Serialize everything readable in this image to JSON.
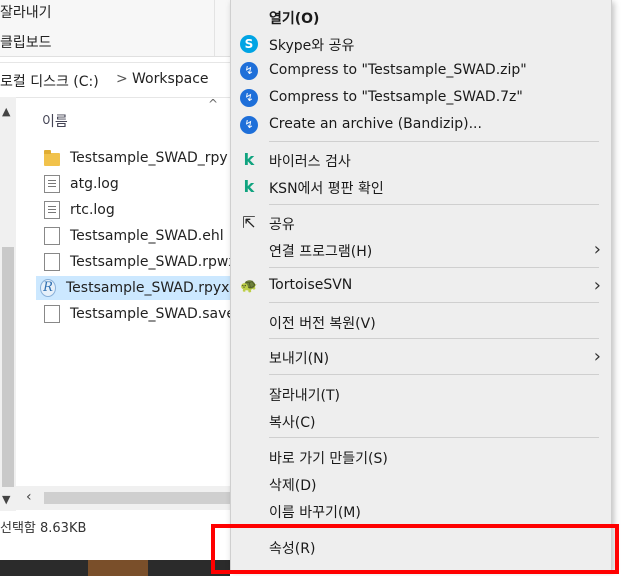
{
  "explorer": {
    "ribbon": {
      "cut_label": "잘라내기",
      "clipboard_label": "클립보드"
    },
    "address": {
      "drive_label": "로컬 디스크 (C:)",
      "separator": ">",
      "folder_label": "Workspace"
    },
    "list": {
      "column_name": "이름",
      "sort_glyph": "^",
      "files": [
        {
          "name": "Testsample_SWAD_rpy",
          "icon": "folder-icon",
          "selected": false
        },
        {
          "name": "atg.log",
          "icon": "text-file-icon",
          "selected": false
        },
        {
          "name": "rtc.log",
          "icon": "text-file-icon",
          "selected": false
        },
        {
          "name": "Testsample_SWAD.ehl",
          "icon": "file-icon",
          "selected": false
        },
        {
          "name": "Testsample_SWAD.rpwx",
          "icon": "file-icon",
          "selected": false
        },
        {
          "name": "Testsample_SWAD.rpyx",
          "icon": "rhapsody-file-icon",
          "selected": true
        },
        {
          "name": "Testsample_SWAD.save",
          "icon": "file-icon",
          "selected": false
        }
      ]
    },
    "status": {
      "selection_text": "선택함 8.63KB"
    }
  },
  "context_menu": {
    "items": [
      {
        "id": "open",
        "label": "열기(O)",
        "icon": "",
        "bold": true
      },
      {
        "id": "skype-share",
        "label": "Skype와 공유",
        "icon": "skype-icon"
      },
      {
        "id": "compress-zip",
        "label": "Compress to \"Testsample_SWAD.zip\"",
        "icon": "bandizip-icon"
      },
      {
        "id": "compress-7z",
        "label": "Compress to \"Testsample_SWAD.7z\"",
        "icon": "bandizip-icon"
      },
      {
        "id": "create-archive",
        "label": "Create an archive (Bandizip)...",
        "icon": "bandizip-icon"
      },
      {
        "id": "virus-scan",
        "label": "바이러스 검사",
        "icon": "kaspersky-icon"
      },
      {
        "id": "ksn-check",
        "label": "KSN에서 평판 확인",
        "icon": "kaspersky-icon"
      },
      {
        "id": "share",
        "label": "공유",
        "icon": "share-icon"
      },
      {
        "id": "open-with",
        "label": "연결 프로그램(H)",
        "icon": "",
        "submenu": true
      },
      {
        "id": "tortoisesvn",
        "label": "TortoiseSVN",
        "icon": "tortoisesvn-icon",
        "submenu": true
      },
      {
        "id": "restore-previous",
        "label": "이전 버전 복원(V)",
        "icon": ""
      },
      {
        "id": "send-to",
        "label": "보내기(N)",
        "icon": "",
        "submenu": true
      },
      {
        "id": "cut",
        "label": "잘라내기(T)",
        "icon": ""
      },
      {
        "id": "copy",
        "label": "복사(C)",
        "icon": ""
      },
      {
        "id": "create-shortcut",
        "label": "바로 가기 만들기(S)",
        "icon": ""
      },
      {
        "id": "delete",
        "label": "삭제(D)",
        "icon": ""
      },
      {
        "id": "rename",
        "label": "이름 바꾸기(M)",
        "icon": ""
      },
      {
        "id": "properties",
        "label": "속성(R)",
        "icon": ""
      }
    ],
    "submenu_glyph": "›",
    "highlighted_item": "properties",
    "highlight_color": "#ff0000"
  }
}
